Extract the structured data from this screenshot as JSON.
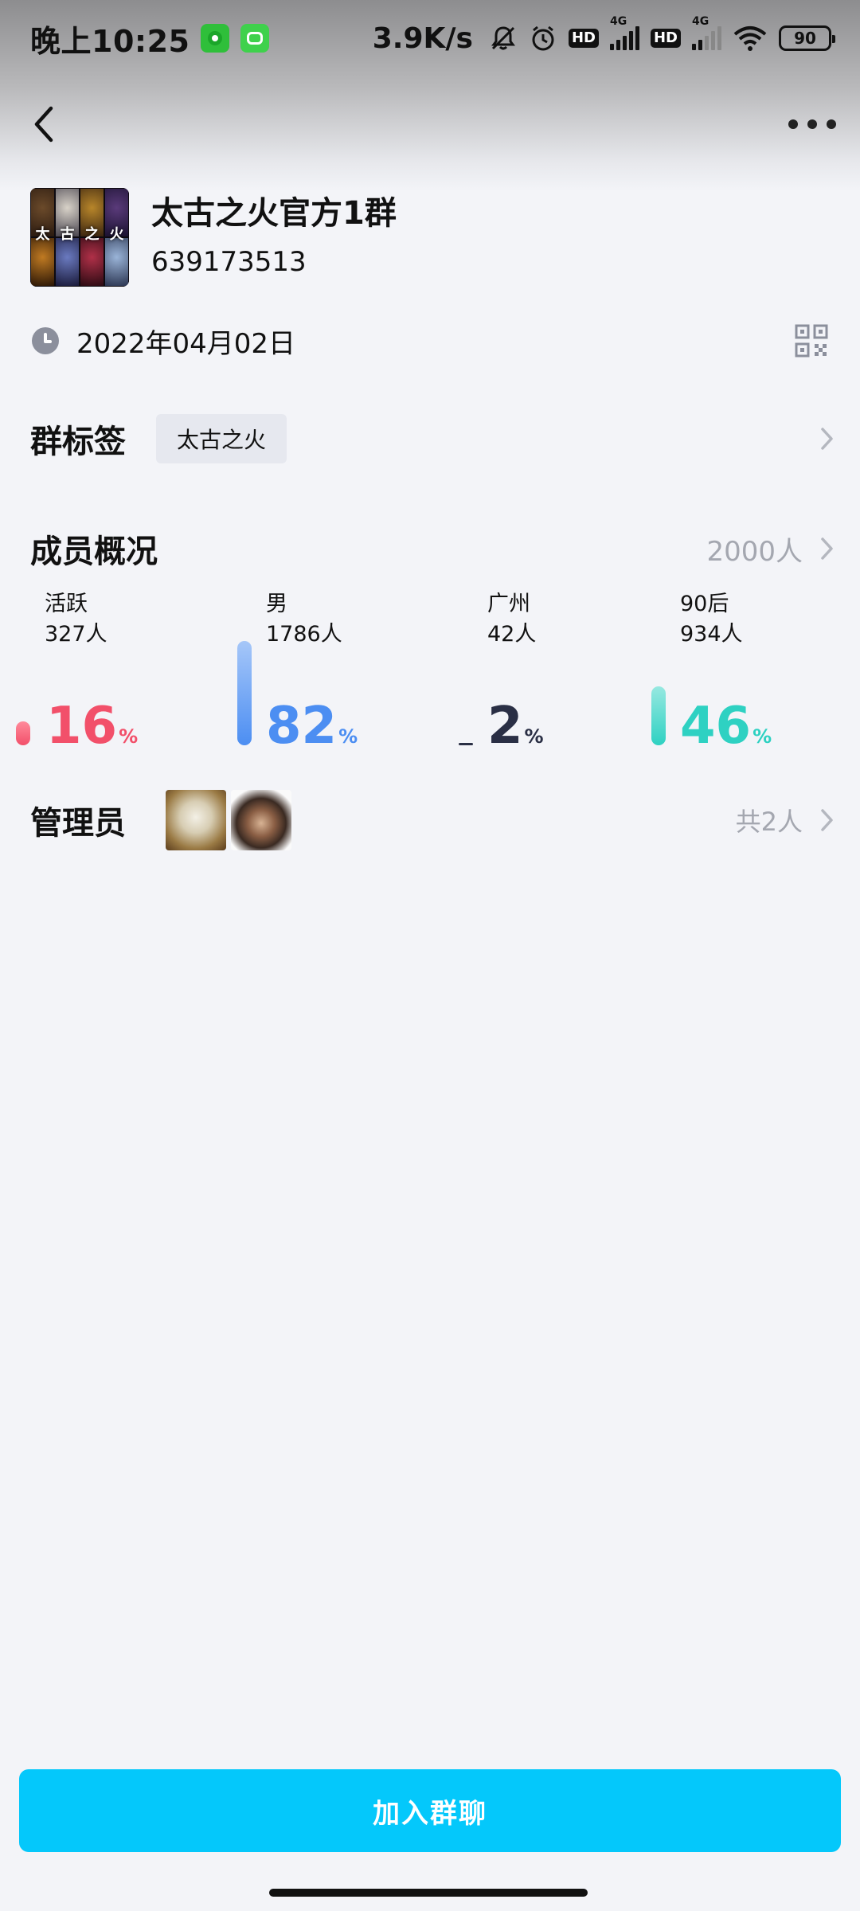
{
  "status_bar": {
    "time": "晚上10:25",
    "net_speed": "3.9K/s",
    "signal_label": "4G",
    "battery": "90",
    "hd_label": "HD",
    "icons": [
      "mute-bell-icon",
      "alarm-icon",
      "hd-icon",
      "signal-icon",
      "wifi-icon",
      "battery-icon"
    ]
  },
  "nav": {
    "back_icon": "back-chevron-icon",
    "more_icon": "more-dots-icon"
  },
  "group": {
    "name": "太古之火官方1群",
    "id": "639173513",
    "avatar_text": [
      "太",
      "古",
      "之",
      "火"
    ],
    "created_date": "2022年04月02日"
  },
  "tags": {
    "title": "群标签",
    "items": [
      "太古之火"
    ]
  },
  "members": {
    "title": "成员概况",
    "total": "2000人",
    "stats": [
      {
        "label": "活跃",
        "count": "327人",
        "percent": "16",
        "unit": "%",
        "color": "#f2506a",
        "bar_fill": 0.16
      },
      {
        "label": "男",
        "count": "1786人",
        "percent": "82",
        "unit": "%",
        "color": "#4c8ef2",
        "bar_fill": 0.82
      },
      {
        "label": "广州",
        "count": "42人",
        "percent": "2",
        "unit": "%",
        "color": "#2a2f45",
        "bar_fill": 0.02
      },
      {
        "label": "90后",
        "count": "934人",
        "percent": "46",
        "unit": "%",
        "color": "#2ed1c2",
        "bar_fill": 0.46
      }
    ]
  },
  "admins": {
    "title": "管理员",
    "count": "共2人"
  },
  "join_button": "加入群聊",
  "colors": {
    "accent": "#04c8fb",
    "background": "#f3f4f8",
    "muted_text": "#a4a7b0"
  }
}
